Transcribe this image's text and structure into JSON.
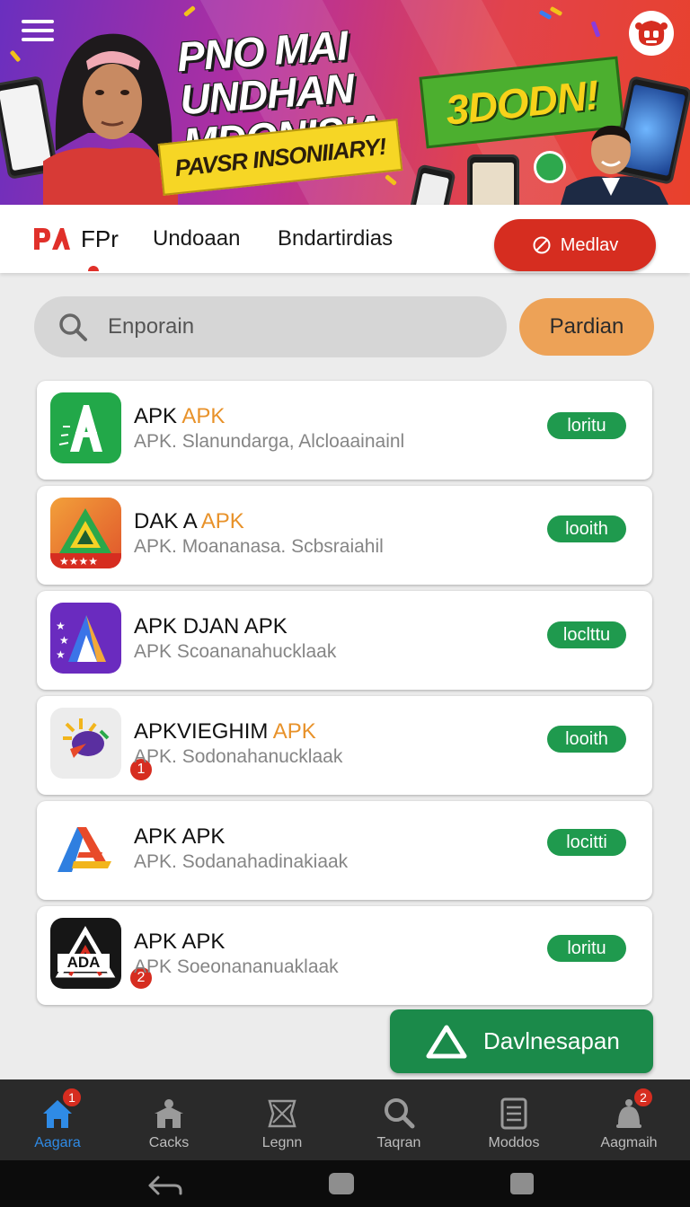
{
  "banner": {
    "headline_line1": "PNO MAI UNDHAN",
    "headline_line2": "MDONISIA",
    "badge_text": "3DODN!",
    "subtitle": "PAVSR INSONIIARY!"
  },
  "topnav": {
    "logo_text": "FPr",
    "links": [
      "Undoaan",
      "Bndartirdias"
    ],
    "media_button": "Medlav"
  },
  "search": {
    "placeholder": "Enporain",
    "button": "Pardian"
  },
  "apps": [
    {
      "title": "APK ",
      "title_accent": "APK",
      "subtitle": "APK. Slanundarga, Alcloaainainl",
      "button": "loritu"
    },
    {
      "title": "DAK A ",
      "title_accent": "APK",
      "subtitle": "APK. Moananasa. Scbsraiahil",
      "button": "looith"
    },
    {
      "title": "APK DJAN APK",
      "title_accent": "",
      "subtitle": "APK Scoananahucklaak",
      "button": "loclttu"
    },
    {
      "title": "APKVIEGHIM ",
      "title_accent": "APK",
      "subtitle": "APK. Sodonahanucklaak",
      "button": "looith",
      "badge": "1"
    },
    {
      "title": "APK APK",
      "title_accent": "",
      "subtitle": "APK. Sodanahadinakiaak",
      "button": "locitti"
    },
    {
      "title": "APK APK",
      "title_accent": "",
      "subtitle": "APK Soeonananuaklaak",
      "button": "loritu",
      "badge": "2",
      "icon_text": "ADA"
    }
  ],
  "download_button": "Davlnesapan",
  "bottom_nav": [
    {
      "label": "Aagara",
      "icon": "home-icon",
      "badge": "1",
      "active": true
    },
    {
      "label": "Cacks",
      "icon": "shop-icon"
    },
    {
      "label": "Legnn",
      "icon": "puzzle-icon"
    },
    {
      "label": "Taqran",
      "icon": "search-icon"
    },
    {
      "label": "Moddos",
      "icon": "document-icon"
    },
    {
      "label": "Aagmaih",
      "icon": "notification-icon",
      "badge": "2"
    }
  ],
  "colors": {
    "accent_red": "#d62d20",
    "install_green": "#1f9a4e",
    "download_green": "#1b8a4a",
    "search_orange": "#eda257",
    "title_accent": "#e8922a",
    "active_tab": "#2f8be6"
  }
}
